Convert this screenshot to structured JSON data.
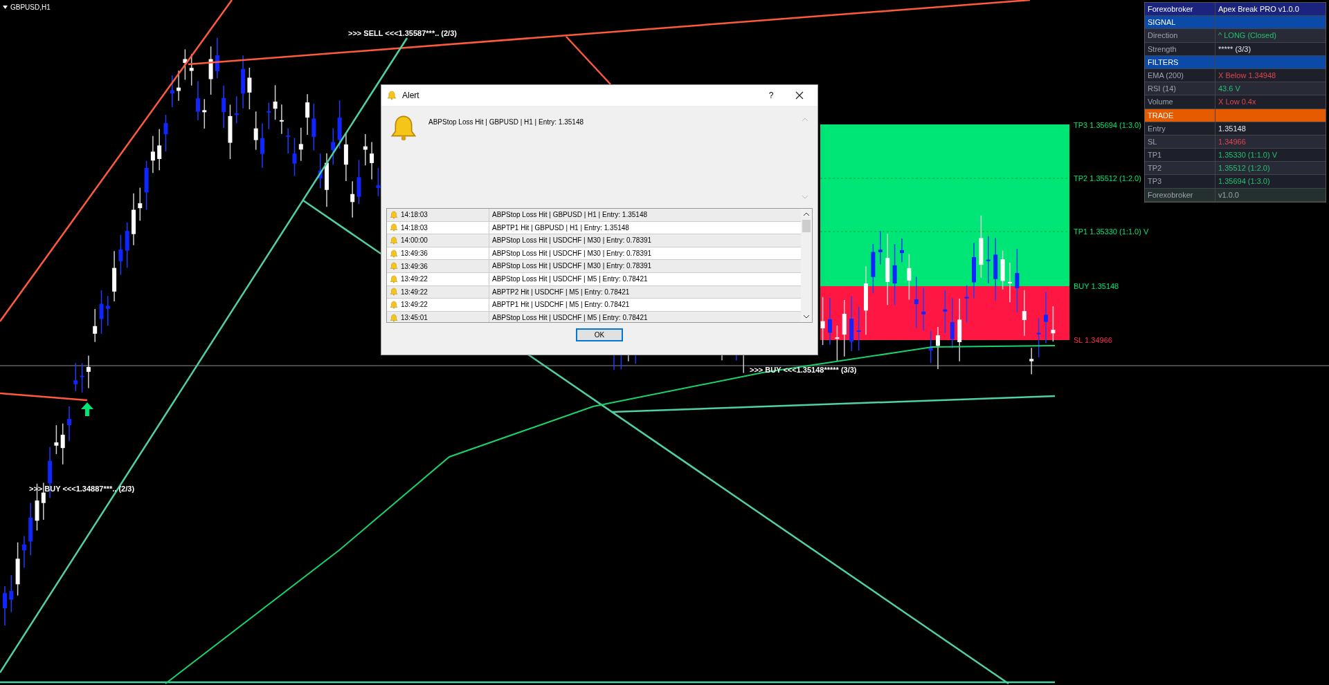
{
  "chart": {
    "symbol": "GBPUSD,H1",
    "signals": [
      {
        "text": ">>> SELL <<<1.35587***.. (2/3)"
      },
      {
        "text": ">>> BUY <<<1.34887***.. (2/3)"
      },
      {
        "text": ">>> BUY <<<1.35148***** (3/3)"
      }
    ],
    "levels": [
      {
        "kind": "tp",
        "text": "TP3 1.35694 (1:3.0)"
      },
      {
        "kind": "tp",
        "text": "TP2 1.35512 (1:2.0)"
      },
      {
        "kind": "tp",
        "text": "TP1 1.35330 (1:1.0) V"
      },
      {
        "kind": "entry",
        "text": "BUY 1.35148"
      },
      {
        "kind": "sl",
        "text": "SL 1.34966"
      }
    ]
  },
  "panel": {
    "rows": [
      {
        "kind": "title",
        "label": "Forexobroker",
        "value": "Apex Break PRO v1.0.0"
      },
      {
        "kind": "section",
        "label": "SIGNAL",
        "color": "#0b4aa8"
      },
      {
        "kind": "row",
        "label": "Direction",
        "value": "^ LONG (Closed)",
        "color": "#22c36b"
      },
      {
        "kind": "row",
        "label": "Strength",
        "value": "***** (3/3)",
        "color": "#e5e7eb"
      },
      {
        "kind": "section",
        "label": "FILTERS",
        "color": "#0b4aa8"
      },
      {
        "kind": "row",
        "label": "EMA (200)",
        "value": "X Below  1.34948",
        "color": "#e0474c"
      },
      {
        "kind": "row",
        "label": "RSI (14)",
        "value": "43.6  V",
        "color": "#22c36b"
      },
      {
        "kind": "row",
        "label": "Volume",
        "value": "X Low  0.4x",
        "color": "#e0474c"
      },
      {
        "kind": "section",
        "label": "TRADE",
        "color": "#e65a00"
      },
      {
        "kind": "row",
        "label": "Entry",
        "value": "1.35148",
        "color": "#e5e7eb"
      },
      {
        "kind": "row",
        "label": "SL",
        "value": "1.34966",
        "color": "#e0474c"
      },
      {
        "kind": "row",
        "label": "TP1",
        "value": "1.35330 (1:1.0) V",
        "color": "#22c36b"
      },
      {
        "kind": "row",
        "label": "TP2",
        "value": "1.35512 (1:2.0)",
        "color": "#22c36b"
      },
      {
        "kind": "row",
        "label": "TP3",
        "value": "1.35694 (1:3.0)",
        "color": "#22c36b"
      },
      {
        "kind": "footer",
        "label": "Forexobroker",
        "value": "v1.0.0"
      }
    ]
  },
  "dialog": {
    "title": "Alert",
    "help": "?",
    "message": "ABPStop Loss Hit | GBPUSD | H1 | Entry: 1.35148",
    "alerts": [
      {
        "time": "14:18:03",
        "text": "ABPStop Loss Hit | GBPUSD | H1 | Entry: 1.35148"
      },
      {
        "time": "14:18:03",
        "text": "ABPTP1 Hit | GBPUSD | H1 | Entry: 1.35148"
      },
      {
        "time": "14:00:00",
        "text": "ABPStop Loss Hit | USDCHF | M30 | Entry: 0.78391"
      },
      {
        "time": "13:49:36",
        "text": "ABPStop Loss Hit | USDCHF | M30 | Entry: 0.78391"
      },
      {
        "time": "13:49:36",
        "text": "ABPStop Loss Hit | USDCHF | M30 | Entry: 0.78391"
      },
      {
        "time": "13:49:22",
        "text": "ABPStop Loss Hit | USDCHF | M5 | Entry: 0.78421"
      },
      {
        "time": "13:49:22",
        "text": "ABPTP2 Hit | USDCHF | M5 | Entry: 0.78421"
      },
      {
        "time": "13:49:22",
        "text": "ABPTP1 Hit | USDCHF | M5 | Entry: 0.78421"
      },
      {
        "time": "13:45:01",
        "text": "ABPStop Loss Hit | USDCHF | M5 | Entry: 0.78421"
      }
    ],
    "ok": "OK"
  }
}
